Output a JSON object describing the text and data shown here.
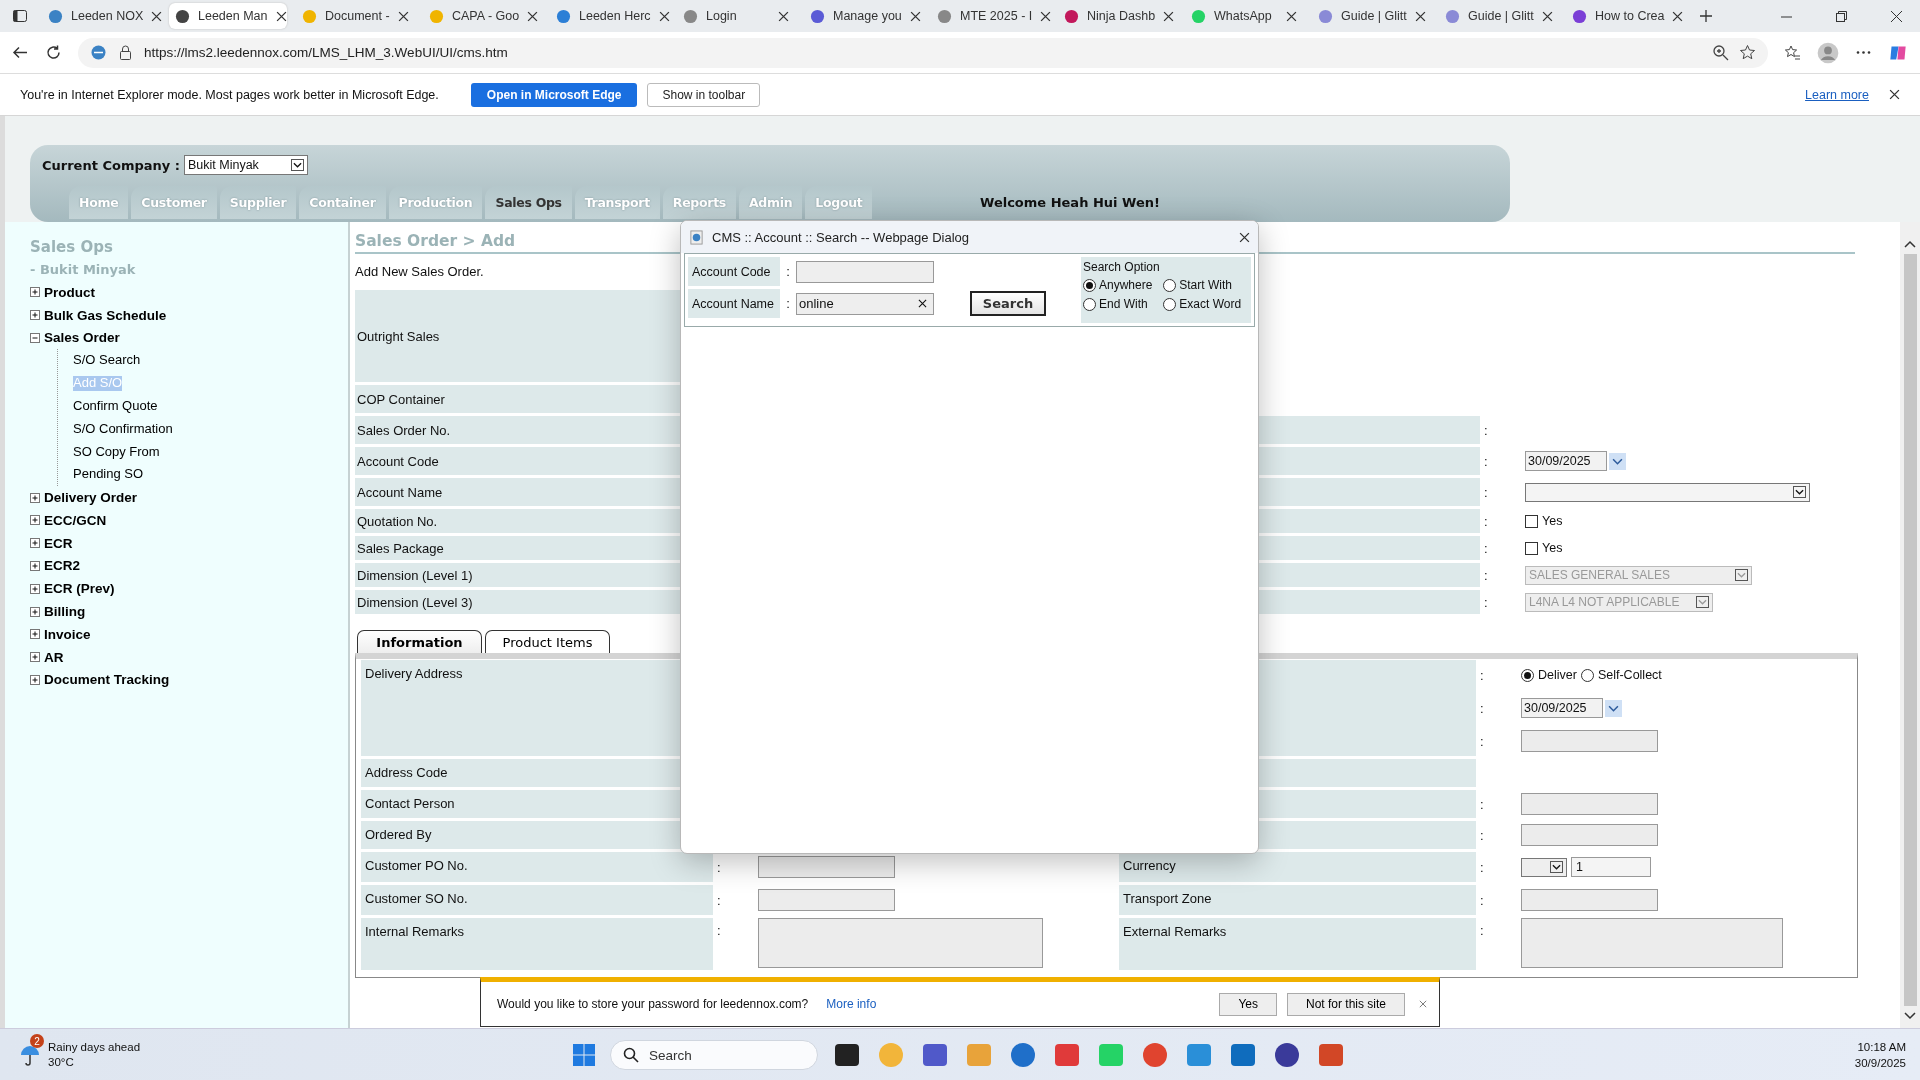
{
  "browser": {
    "tabs": [
      {
        "title": "Leeden NOX",
        "selected": false
      },
      {
        "title": "Leeden Man",
        "selected": true
      },
      {
        "title": "Document -",
        "selected": false
      },
      {
        "title": "CAPA - Goo",
        "selected": false
      },
      {
        "title": "Leeden Herc",
        "selected": false
      },
      {
        "title": "Login",
        "selected": false
      },
      {
        "title": "Manage you",
        "selected": false
      },
      {
        "title": "MTE 2025 - I",
        "selected": false
      },
      {
        "title": "Ninja Dashb",
        "selected": false
      },
      {
        "title": "WhatsApp",
        "selected": false
      },
      {
        "title": "Guide | Glitt",
        "selected": false
      },
      {
        "title": "Guide | Glitt",
        "selected": false
      },
      {
        "title": "How to Crea",
        "selected": false
      }
    ],
    "url": "https://lms2.leedennox.com/LMS_LHM_3.WebUI/UI/cms.htm",
    "infobar": {
      "message": "You're in Internet Explorer mode. Most pages work better in Microsoft Edge.",
      "primary_button": "Open in Microsoft Edge",
      "secondary_button": "Show in toolbar",
      "link": "Learn more"
    }
  },
  "app": {
    "company_label": "Current Company :",
    "company": "Bukit Minyak",
    "nav": [
      {
        "label": "Home",
        "selected": false
      },
      {
        "label": "Customer",
        "selected": false
      },
      {
        "label": "Supplier",
        "selected": false
      },
      {
        "label": "Container",
        "selected": false
      },
      {
        "label": "Production",
        "selected": false
      },
      {
        "label": "Sales Ops",
        "selected": true
      },
      {
        "label": "Transport",
        "selected": false
      },
      {
        "label": "Reports",
        "selected": false
      },
      {
        "label": "Admin",
        "selected": false
      },
      {
        "label": "Logout",
        "selected": false
      }
    ],
    "welcome": "Welcome Heah Hui Wen!"
  },
  "sidebar": {
    "title": "Sales Ops",
    "subtitle": "- Bukit Minyak",
    "tree": [
      {
        "label": "Product",
        "expanded": false
      },
      {
        "label": "Bulk Gas Schedule",
        "expanded": false
      },
      {
        "label": "Sales Order",
        "expanded": true,
        "children": [
          {
            "label": "S/O Search",
            "selected": false
          },
          {
            "label": "Add S/O",
            "selected": true
          },
          {
            "label": "Confirm Quote",
            "selected": false
          },
          {
            "label": "S/O Confirmation",
            "selected": false
          },
          {
            "label": "SO Copy From",
            "selected": false
          },
          {
            "label": "Pending SO",
            "selected": false
          }
        ]
      },
      {
        "label": "Delivery Order",
        "expanded": false
      },
      {
        "label": "ECC/GCN",
        "expanded": false
      },
      {
        "label": "ECR",
        "expanded": false
      },
      {
        "label": "ECR2",
        "expanded": false
      },
      {
        "label": "ECR (Prev)",
        "expanded": false
      },
      {
        "label": "Billing",
        "expanded": false
      },
      {
        "label": "Invoice",
        "expanded": false
      },
      {
        "label": "AR",
        "expanded": false
      },
      {
        "label": "Document Tracking",
        "expanded": false
      }
    ]
  },
  "page": {
    "title": "Sales Order > Add",
    "intro": "Add New Sales Order.",
    "form": [
      {
        "label": "Outright Sales"
      },
      {
        "label": "COP Container"
      },
      {
        "label": "Sales Order No.",
        "right": {
          "kind": "empty",
          "sep": ":"
        }
      },
      {
        "label": "Account Code",
        "right": {
          "kind": "date",
          "sep": ":",
          "value": "30/09/2025"
        }
      },
      {
        "label": "Account Name",
        "right": {
          "kind": "select",
          "sep": ":",
          "disabled": false
        }
      },
      {
        "label": "Quotation No.",
        "right": {
          "kind": "checkbox",
          "sep": ":",
          "label": "Yes",
          "checked": false
        }
      },
      {
        "label": "Sales Package",
        "right": {
          "kind": "checkbox",
          "sep": ":",
          "label": "Yes",
          "checked": false
        }
      },
      {
        "label": "Dimension (Level 1)",
        "right": {
          "kind": "select",
          "sep": ":",
          "value": "SALES GENERAL SALES",
          "disabled": true
        }
      },
      {
        "label": "Dimension (Level 3)",
        "right": {
          "kind": "select",
          "sep": ":",
          "value": "L4NA L4 NOT APPLICABLE",
          "disabled": true
        }
      }
    ],
    "tabs": [
      {
        "label": "Information",
        "selected": true
      },
      {
        "label": "Product Items",
        "selected": false
      }
    ],
    "info_rows": [
      {
        "label": "Delivery Address",
        "right_fields": [
          {
            "kind": "radio",
            "sep": ":",
            "options": [
              {
                "label": "Deliver",
                "selected": true
              },
              {
                "label": "Self-Collect",
                "selected": false
              }
            ]
          },
          {
            "kind": "date",
            "sep": ":",
            "value": "30/09/2025"
          },
          {
            "kind": "input",
            "sep": ":"
          }
        ]
      },
      {
        "label": "Address Code"
      },
      {
        "label": "Contact Person",
        "right_fields": [
          {
            "kind": "input",
            "sep": ":"
          }
        ]
      },
      {
        "label": "Ordered By",
        "right_fields": [
          {
            "kind": "input",
            "sep": ":"
          }
        ]
      },
      {
        "label": "Customer PO No.",
        "sep": ":",
        "field": {
          "kind": "input"
        },
        "right_label": "Currency",
        "right_fields": [
          {
            "kind": "currency",
            "sep": ":",
            "value": "1"
          }
        ]
      },
      {
        "label": "Customer SO No.",
        "sep": ":",
        "field": {
          "kind": "input"
        },
        "right_label": "Transport Zone",
        "right_fields": [
          {
            "kind": "input",
            "sep": ":"
          }
        ]
      },
      {
        "label": "Internal Remarks",
        "sep": ":",
        "field": {
          "kind": "textarea"
        },
        "right_label": "External Remarks",
        "right_fields": [
          {
            "kind": "textarea",
            "sep": ":"
          }
        ]
      }
    ]
  },
  "dialog": {
    "title": "CMS :: Account :: Search -- Webpage Dialog",
    "fields": [
      {
        "label": "Account Code",
        "sep": ":",
        "clearable": false
      },
      {
        "label": "Account Name",
        "sep": ":",
        "value": "online",
        "clearable": true
      }
    ],
    "button": "Search",
    "options_title": "Search Option",
    "options": [
      {
        "label": "Anywhere",
        "selected": true
      },
      {
        "label": "Start With",
        "selected": false
      },
      {
        "label": "End With",
        "selected": false
      },
      {
        "label": "Exact Word",
        "selected": false
      }
    ]
  },
  "password_prompt": {
    "message": "Would you like to store your password for leedennox.com?",
    "link": "More info",
    "accept": "Yes",
    "decline": "Not for this site"
  },
  "taskbar": {
    "weather": {
      "badge": "2",
      "summary": "Rainy days ahead",
      "temperature": "30°C"
    },
    "search_placeholder": "Search",
    "time": "10:18 AM",
    "date": "30/9/2025"
  }
}
